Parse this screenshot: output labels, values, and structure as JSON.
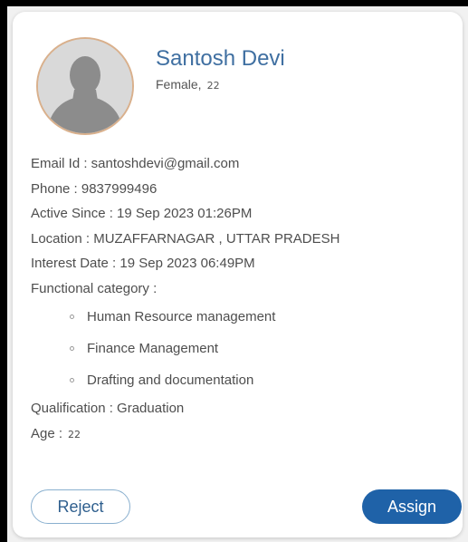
{
  "profile": {
    "name": "Santosh Devi",
    "gender": "Female,",
    "age_header": "22"
  },
  "details": {
    "email": "Email Id : santoshdevi@gmail.com",
    "phone": "Phone : 9837999496",
    "active_since": "Active Since : 19 Sep 2023 01:26PM",
    "location": "Location : MUZAFFARNAGAR , UTTAR PRADESH",
    "interest_date": "Interest Date : 19 Sep 2023 06:49PM",
    "functional_category_label": "Functional category :",
    "functional_categories": [
      "Human Resource management",
      "Finance Management",
      "Drafting and documentation"
    ],
    "qualification": "Qualification : Graduation",
    "age_label": "Age :",
    "age_value": "22"
  },
  "actions": {
    "reject_label": "Reject",
    "assign_label": "Assign"
  },
  "colors": {
    "name": "#3f6fa1",
    "assign_bg": "#1f62a8",
    "reject_border": "#8ab0cf",
    "avatar_ring": "#d9b08c"
  },
  "icons": {
    "avatar": "person-silhouette-icon"
  }
}
